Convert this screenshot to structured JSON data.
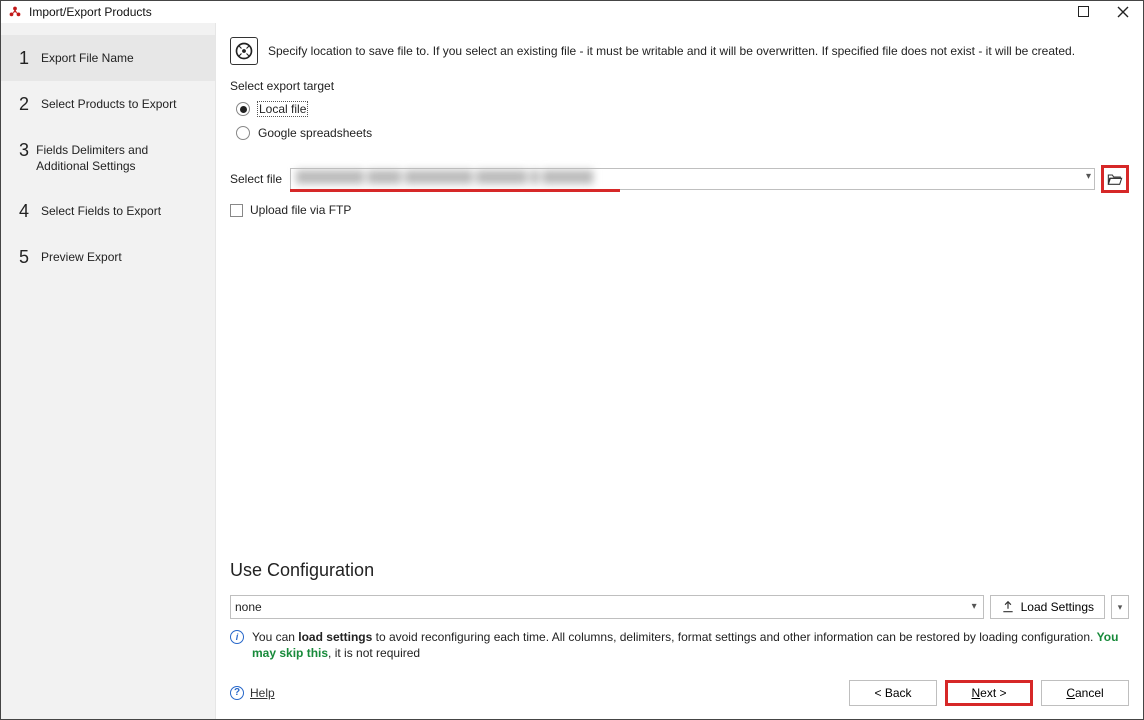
{
  "window": {
    "title": "Import/Export Products"
  },
  "sidebar": {
    "steps": [
      {
        "num": "1",
        "label": "Export File Name"
      },
      {
        "num": "2",
        "label": "Select Products to Export"
      },
      {
        "num": "3",
        "label": "Fields Delimiters and Additional Settings"
      },
      {
        "num": "4",
        "label": "Select Fields to Export"
      },
      {
        "num": "5",
        "label": "Preview Export"
      }
    ]
  },
  "header": {
    "text": "Specify location to save file to. If you select an existing file - it must be writable and it will be overwritten. If specified file does not exist - it will be created."
  },
  "target": {
    "section_label": "Select export target",
    "option_local": "Local file",
    "option_google": "Google spreadsheets"
  },
  "file": {
    "label": "Select file",
    "value_redacted": "████████ ████ ████████ ██████ █ ██████ █"
  },
  "upload": {
    "label": "Upload file via FTP"
  },
  "config": {
    "heading": "Use Configuration",
    "selected": "none",
    "load_label": "Load Settings",
    "info_pre": "You can ",
    "info_bold1": "load settings",
    "info_mid": " to avoid reconfiguring each time. All columns, delimiters, format settings and other information can be restored by loading configuration. ",
    "info_green": "You may skip this",
    "info_post": ", it is not required"
  },
  "footer": {
    "help": "Help",
    "back": "< Back",
    "next_pre": "N",
    "next_post": "ext >",
    "cancel_pre": "C",
    "cancel_post": "ancel"
  }
}
